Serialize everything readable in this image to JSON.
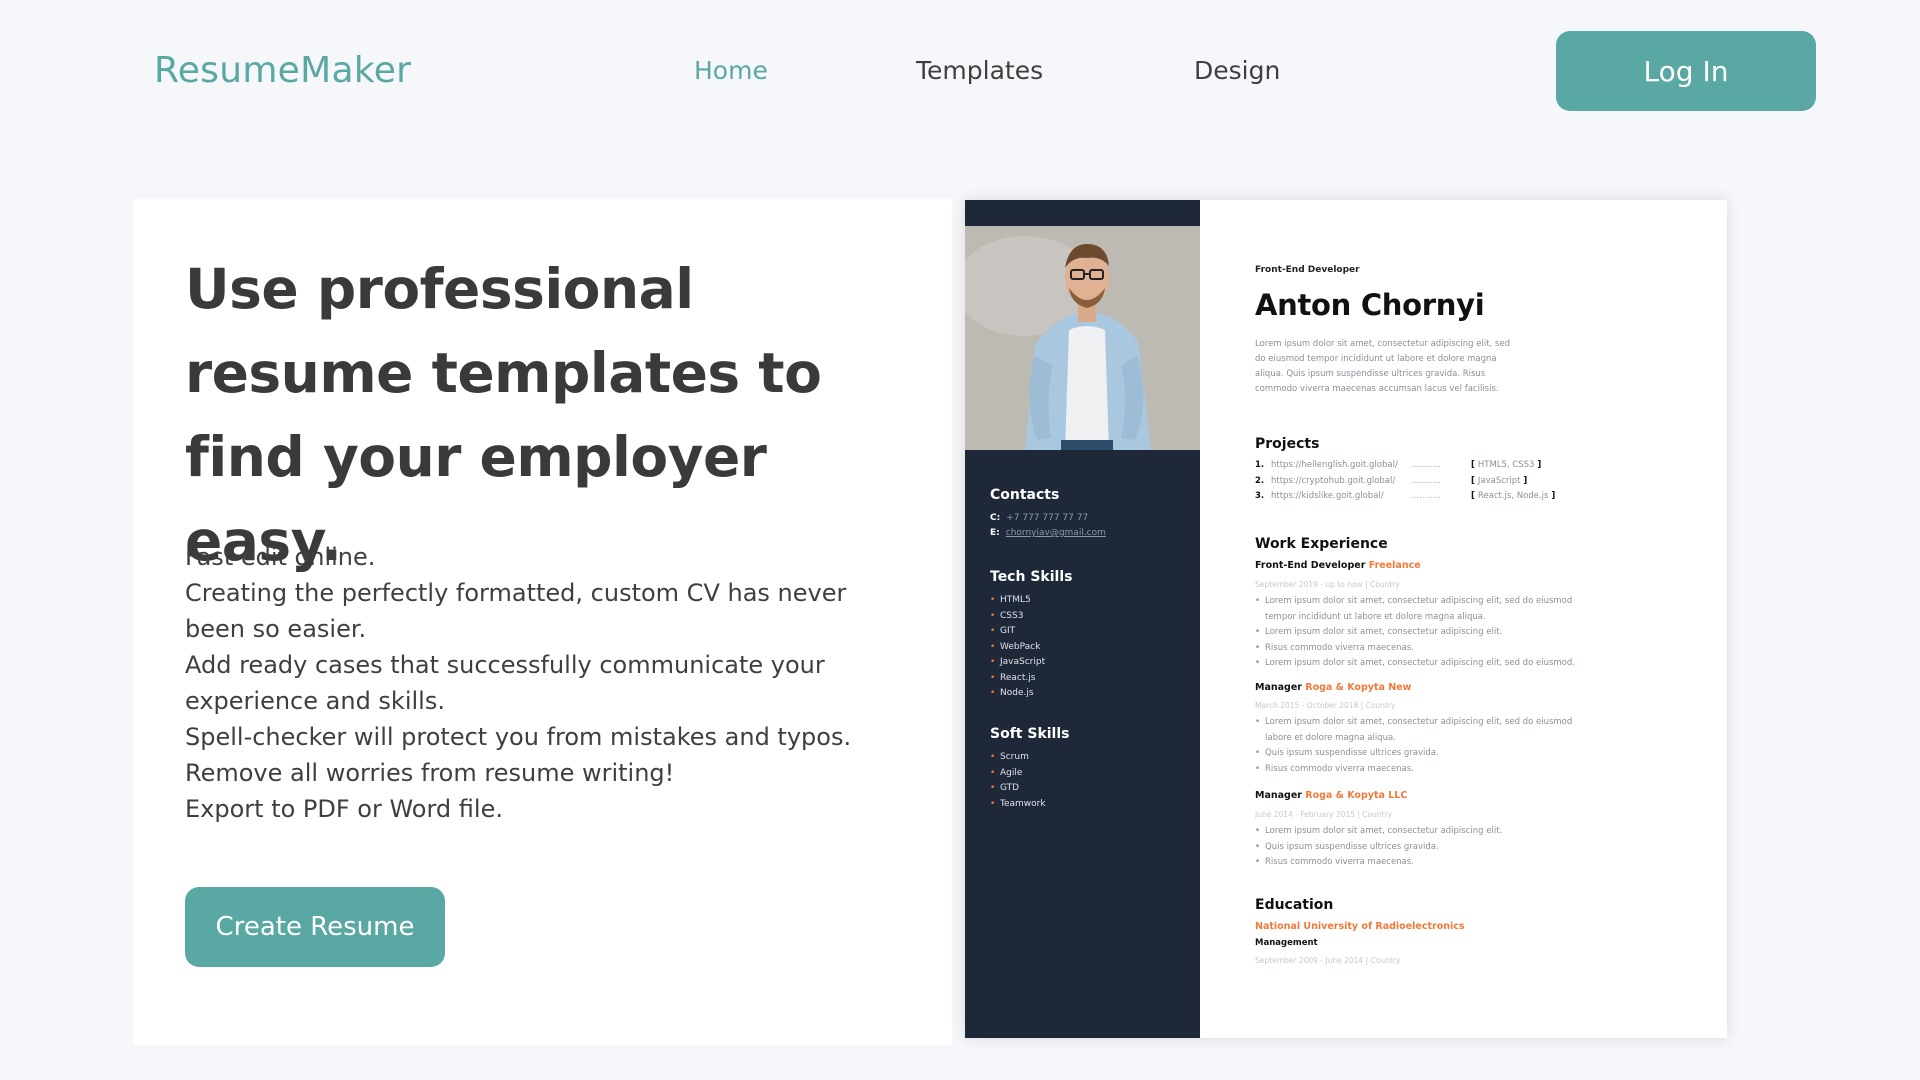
{
  "brand": {
    "logo": "ResumeMaker",
    "accent": "#5aa8a3",
    "orange": "#f07a3a",
    "sidebar_bg": "#1f2838"
  },
  "nav": {
    "links": [
      {
        "label": "Home",
        "active": true
      },
      {
        "label": "Templates",
        "active": false
      },
      {
        "label": "Design",
        "active": false
      }
    ],
    "login_label": "Log In"
  },
  "hero": {
    "headline": "Use professional resume templates to find your employer easy.",
    "lines": [
      "Fast edit online.",
      "Creating the perfectly formatted, custom CV has never been so easier.",
      "Add ready cases that successfully communicate your experience and skills.",
      "Spell-checker will protect you from mistakes and typos.",
      "Remove all worries from resume writing!",
      "Export to PDF or Word file."
    ],
    "cta_label": "Create Resume"
  },
  "resume": {
    "role": "Front-End Developer",
    "name": "Anton Chornyi",
    "bio": "Lorem ipsum dolor sit amet, consectetur adipiscing elit, sed do eiusmod tempor incididunt ut labore et dolore magna aliqua. Quis ipsum suspendisse ultrices gravida. Risus commodo viverra maecenas accumsan lacus vel facilisis.",
    "contacts": {
      "title": "Contacts",
      "phone_label": "C:",
      "phone": "+7 777 777 77 77",
      "email_label": "E:",
      "email": "chornyiav@gmail.com"
    },
    "tech_skills": {
      "title": "Tech Skills",
      "items": [
        "HTML5",
        "CSS3",
        "GIT",
        "WebPack",
        "JavaScript",
        "React.js",
        "Node.js"
      ]
    },
    "soft_skills": {
      "title": "Soft Skills",
      "items": [
        "Scrum",
        "Agile",
        "GTD",
        "Teamwork"
      ]
    },
    "projects": {
      "title": "Projects",
      "items": [
        {
          "n": "1.",
          "url": "https://hellenglish.goit.global/",
          "tech": "HTML5, CSS3"
        },
        {
          "n": "2.",
          "url": "https://cryptohub.goit.global/",
          "tech": "JavaScript"
        },
        {
          "n": "3.",
          "url": "https://kidslike.goit.global/",
          "tech": "React.js, Node.js"
        }
      ]
    },
    "experience": {
      "title": "Work Experience",
      "jobs": [
        {
          "role": "Front-End Developer",
          "company": "Freelance",
          "dates": "September 2019 - up to now  |  Country",
          "bullets": [
            "Lorem ipsum dolor sit amet, consectetur adipiscing elit, sed do eiusmod tempor incididunt ut labore et dolore magna aliqua.",
            "Lorem ipsum dolor sit amet, consectetur adipiscing elit.",
            "Risus commodo viverra maecenas.",
            "Lorem ipsum dolor sit amet, consectetur adipiscing elit, sed do eiusmod."
          ]
        },
        {
          "role": "Manager",
          "company": "Roga & Kopyta New",
          "dates": "March 2015 - October 2018  |  Country",
          "bullets": [
            "Lorem ipsum dolor sit amet, consectetur adipiscing elit, sed do eiusmod labore et dolore magna aliqua.",
            "Quis ipsum suspendisse ultrices gravida.",
            "Risus commodo viverra maecenas."
          ]
        },
        {
          "role": "Manager",
          "company": "Roga & Kopyta LLC",
          "dates": "June 2014 - February 2015  |  Country",
          "bullets": [
            "Lorem ipsum dolor sit amet, consectetur adipiscing elit.",
            "Quis ipsum suspendisse ultrices gravida.",
            "Risus commodo viverra maecenas."
          ]
        }
      ]
    },
    "education": {
      "title": "Education",
      "school": "National University of Radioelectronics",
      "degree": "Management",
      "dates": "September 2009 - June 2014  |  Country"
    }
  }
}
